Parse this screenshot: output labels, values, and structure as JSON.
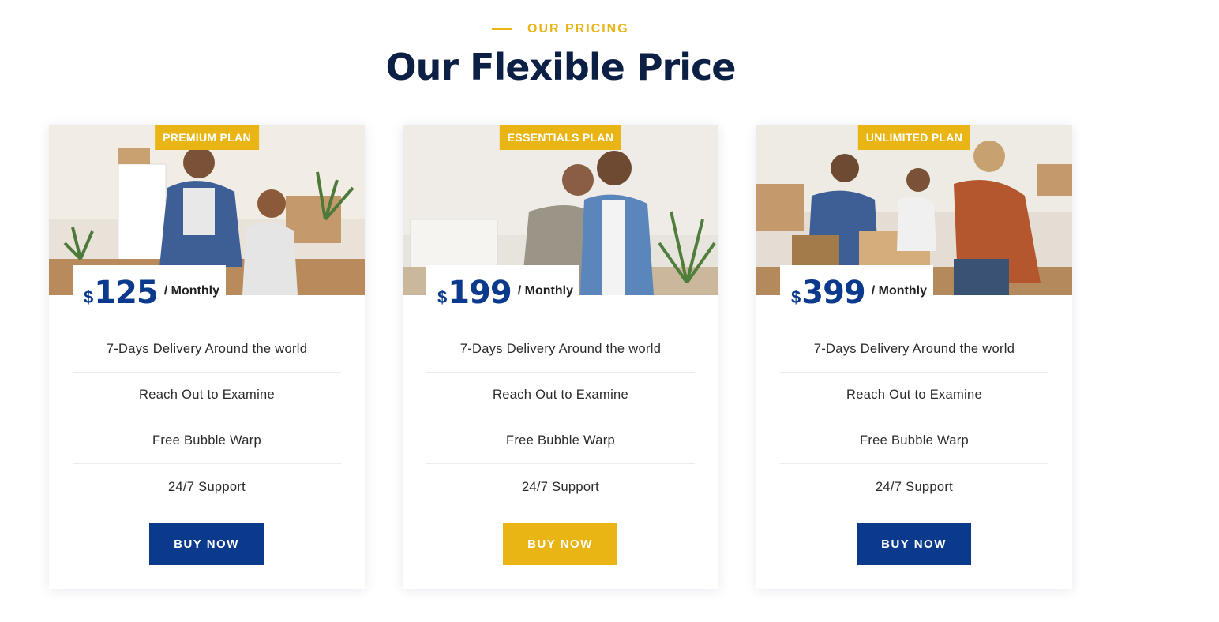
{
  "header": {
    "eyebrow": "OUR PRICING",
    "title": "Our Flexible Price"
  },
  "colors": {
    "accent_yellow": "#e8b514",
    "brand_blue": "#0b3a8c",
    "title_navy": "#0c1f45"
  },
  "plans": [
    {
      "badge": "PREMIUM PLAN",
      "currency": "$",
      "price": "125",
      "period": "/ Monthly",
      "features": [
        "7-Days Delivery Around the world",
        "Reach Out to Examine",
        "Free Bubble Warp",
        "24/7 Support"
      ],
      "button": "BUY NOW",
      "button_color": "#0b3a8c",
      "image": "family-moving-photo"
    },
    {
      "badge": "ESSENTIALS PLAN",
      "currency": "$",
      "price": "199",
      "period": "/ Monthly",
      "features": [
        "7-Days Delivery Around the world",
        "Reach Out to Examine",
        "Free Bubble Warp",
        "24/7 Support"
      ],
      "button": "BUY NOW",
      "button_color": "#e8b514",
      "image": "couple-new-home-photo"
    },
    {
      "badge": "UNLIMITED PLAN",
      "currency": "$",
      "price": "399",
      "period": "/ Monthly",
      "features": [
        "7-Days Delivery Around the world",
        "Reach Out to Examine",
        "Free Bubble Warp",
        "24/7 Support"
      ],
      "button": "BUY NOW",
      "button_color": "#0b3a8c",
      "image": "family-unpacking-photo"
    }
  ]
}
